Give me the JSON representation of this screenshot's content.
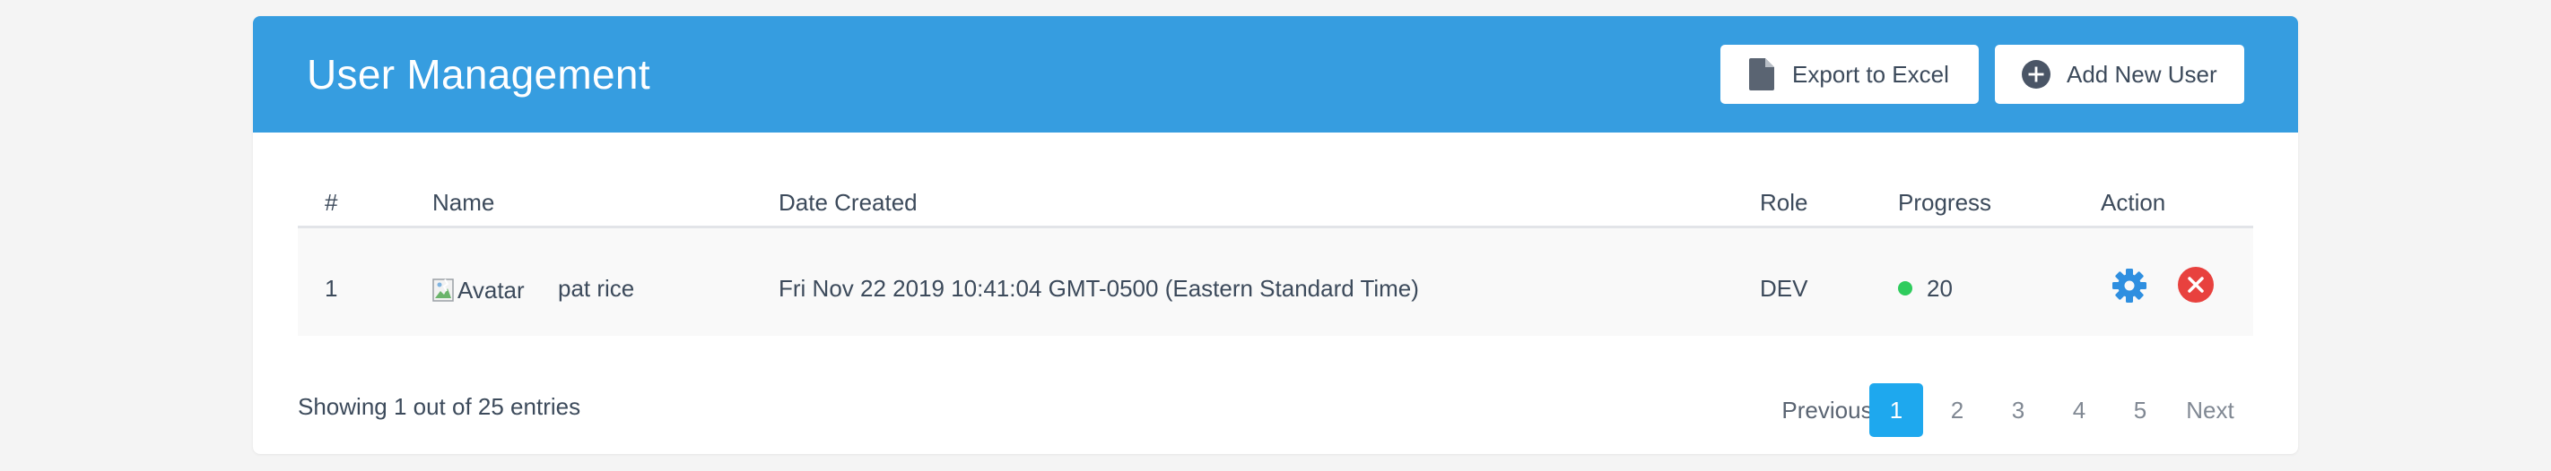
{
  "header": {
    "title": "User Management",
    "export_label": "Export to Excel",
    "add_label": "Add New User",
    "background_color": "#369de0"
  },
  "table": {
    "columns": [
      "#",
      "Name",
      "Date Created",
      "Role",
      "Progress",
      "Action"
    ],
    "rows": [
      {
        "num": "1",
        "avatar_alt": "Avatar",
        "name": "pat rice",
        "date_created": "Fri Nov 22 2019 10:41:04 GMT-0500 (Eastern Standard Time)",
        "role": "DEV",
        "progress": "20",
        "status_color": "#2fcc5d",
        "actions": [
          "gear-icon",
          "delete-icon"
        ]
      }
    ]
  },
  "footer": {
    "showing_text": "Showing 1 out of 25 entries",
    "pagination": {
      "previous": "Previous",
      "pages": [
        "1",
        "2",
        "3",
        "4",
        "5"
      ],
      "active_page": "1",
      "next": "Next",
      "active_color": "#1ea8ee"
    }
  }
}
